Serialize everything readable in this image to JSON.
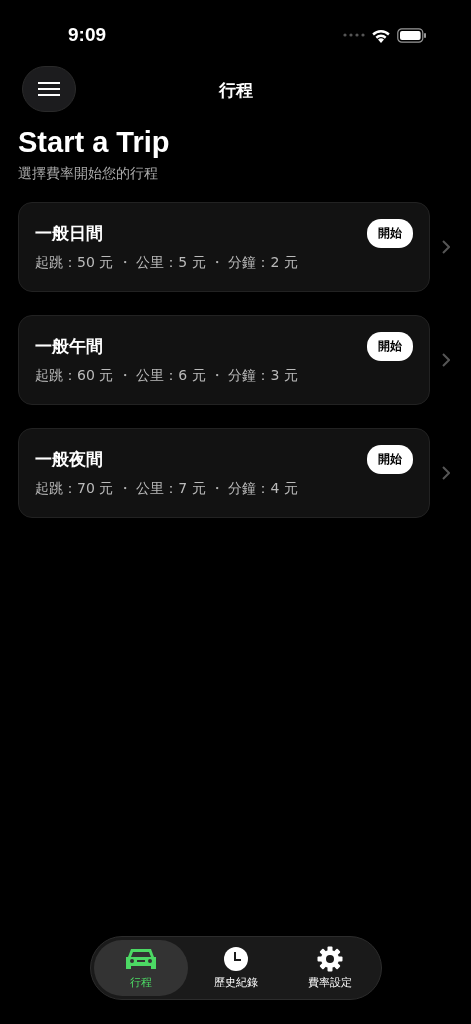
{
  "status_bar": {
    "time": "9:09"
  },
  "header": {
    "title": "行程"
  },
  "heading": "Start a Trip",
  "subtitle": "選擇費率開始您的行程",
  "rates": [
    {
      "name": "一般日間",
      "details": "起跳：50 元 ・ 公里：5 元 ・ 分鐘：2 元",
      "button": "開始"
    },
    {
      "name": "一般午間",
      "details": "起跳：60 元 ・ 公里：6 元 ・ 分鐘：3 元",
      "button": "開始"
    },
    {
      "name": "一般夜間",
      "details": "起跳：70 元 ・ 公里：7 元 ・ 分鐘：4 元",
      "button": "開始"
    }
  ],
  "tab_bar": [
    {
      "label": "行程",
      "kind": "car",
      "selected": true
    },
    {
      "label": "歷史紀錄",
      "kind": "clock",
      "selected": false
    },
    {
      "label": "費率設定",
      "kind": "gear",
      "selected": false
    }
  ]
}
